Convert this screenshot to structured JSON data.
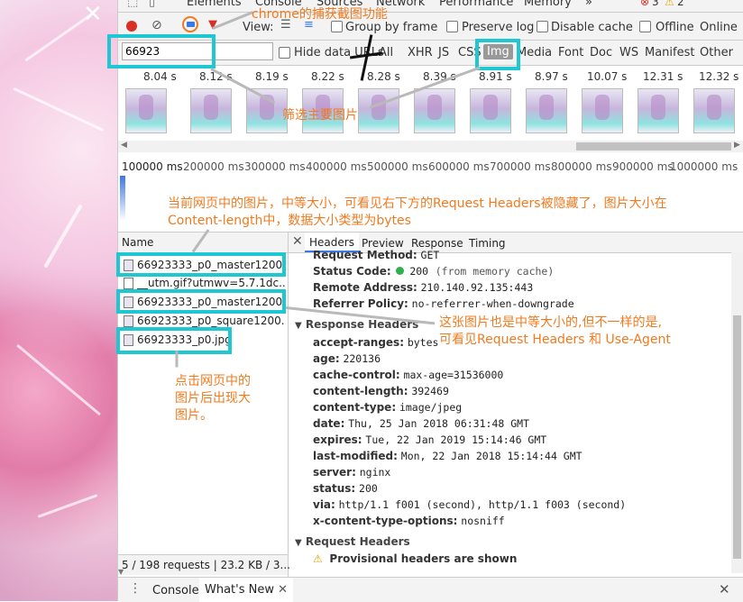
{
  "top_tabs": [
    "Elements",
    "Console",
    "Sources",
    "Network",
    "Performance",
    "Memory"
  ],
  "top_overflow": "»",
  "error_count": "3",
  "warn_count": "2",
  "toolbar2": {
    "view_label": "View:",
    "group_by_frame": "Group by frame",
    "preserve_log": "Preserve log",
    "disable_cache": "Disable cache",
    "offline": "Offline",
    "online": "Online"
  },
  "filter": {
    "value": "66923",
    "hide_data_urls": "Hide data URLs",
    "all": "All",
    "types": [
      "XHR",
      "JS",
      "CSS",
      "Img",
      "Media",
      "Font",
      "Doc",
      "WS",
      "Manifest",
      "Other"
    ]
  },
  "filmstrip_times": [
    "8.04 s",
    "8.12 s",
    "8.19 s",
    "8.22 s",
    "8.28 s",
    "8.39 s",
    "8.91 s",
    "8.97 s",
    "10.07 s",
    "12.31 s",
    "12.32 s"
  ],
  "overview_ticks": [
    "100000 ms",
    "200000 ms",
    "300000 ms",
    "400000 ms",
    "500000 ms",
    "600000 ms",
    "700000 ms",
    "800000 ms",
    "900000 ms",
    "1000000 ms"
  ],
  "list": {
    "name_header": "Name",
    "items": [
      "66923333_p0_master1200...",
      "__utm.gif?utmwv=5.7.1dc...",
      "66923333_p0_master1200...",
      "66923333_p0_square1200...",
      "66923333_p0.jpg"
    ],
    "status": "5 / 198 requests | 23.2 KB / 3..."
  },
  "detail_tabs": [
    "Headers",
    "Preview",
    "Response",
    "Timing"
  ],
  "general": {
    "request_method_label": "Request Method:",
    "request_method": "GET",
    "status_code_label": "Status Code:",
    "status_code": "200",
    "status_note": "(from memory cache)",
    "remote_address_label": "Remote Address:",
    "remote_address": "210.140.92.135:443",
    "referrer_policy_label": "Referrer Policy:",
    "referrer_policy": "no-referrer-when-downgrade"
  },
  "response_headers_title": "Response Headers",
  "response_headers": [
    {
      "k": "accept-ranges:",
      "v": "bytes"
    },
    {
      "k": "age:",
      "v": "220136"
    },
    {
      "k": "cache-control:",
      "v": "max-age=31536000"
    },
    {
      "k": "content-length:",
      "v": "392469"
    },
    {
      "k": "content-type:",
      "v": "image/jpeg"
    },
    {
      "k": "date:",
      "v": "Thu, 25 Jan 2018 06:31:48 GMT"
    },
    {
      "k": "expires:",
      "v": "Tue, 22 Jan 2019 15:14:46 GMT"
    },
    {
      "k": "last-modified:",
      "v": "Mon, 22 Jan 2018 15:14:44 GMT"
    },
    {
      "k": "server:",
      "v": "nginx"
    },
    {
      "k": "status:",
      "v": "200"
    },
    {
      "k": "via:",
      "v": "http/1.1 f001 (second), http/1.1 f003 (second)"
    },
    {
      "k": "x-content-type-options:",
      "v": "nosniff"
    }
  ],
  "request_headers_title": "Request Headers",
  "provisional": "Provisional headers are shown",
  "drawer_tabs": [
    "Console",
    "What's New"
  ],
  "annotations": {
    "a1": "chrome的捕获截图功能",
    "a2": "筛选主要图片",
    "a3_line1": "当前网页中的图片，中等大小，可看见右下方的Request Headers被隐藏了，图片大小在",
    "a3_line2": "Content-length中，数据大小类型为bytes",
    "a4_line1": "这张图片也是中等大小的,但不一样的是,",
    "a4_line2": "可看见Request Headers 和 Use-Agent",
    "a5_line1": "点击网页中的",
    "a5_line2": "图片后出现大",
    "a5_line3": "图片。"
  },
  "colors": {
    "highlight": "#1ec8d2",
    "annotation": "#f07a1f",
    "record": "#d93025"
  }
}
